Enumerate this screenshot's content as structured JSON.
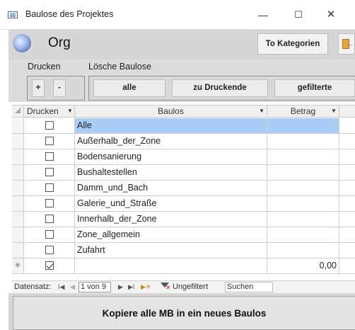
{
  "window": {
    "title": "Baulose des Projektes",
    "minimize_glyph": "—",
    "maximize_glyph": "☐",
    "close_glyph": "✕"
  },
  "header": {
    "title": "Org",
    "to_categories_label": "To Kategorien"
  },
  "controls": {
    "drucken_label": "Drucken",
    "loesche_label": "Lösche Baulose",
    "plus_label": "+",
    "minus_label": "-",
    "alle_label": "alle",
    "zu_druckende_label": "zu Druckende",
    "gefilterte_label": "gefilterte"
  },
  "table": {
    "columns": [
      "Drucken",
      "Baulos",
      "Betrag"
    ],
    "rows": [
      {
        "drucken": false,
        "baulos": "Alle",
        "betrag": "",
        "selected": true
      },
      {
        "drucken": false,
        "baulos": "Außerhalb_der_Zone",
        "betrag": ""
      },
      {
        "drucken": false,
        "baulos": "Bodensanierung",
        "betrag": ""
      },
      {
        "drucken": false,
        "baulos": "Bushaltestellen",
        "betrag": ""
      },
      {
        "drucken": false,
        "baulos": "Damm_und_Bach",
        "betrag": ""
      },
      {
        "drucken": false,
        "baulos": "Galerie_und_Straße",
        "betrag": ""
      },
      {
        "drucken": false,
        "baulos": "Innerhalb_der_Zone",
        "betrag": ""
      },
      {
        "drucken": false,
        "baulos": "Zone_allgemein",
        "betrag": ""
      },
      {
        "drucken": false,
        "baulos": "Zufahrt",
        "betrag": ""
      }
    ],
    "new_row": {
      "marker": "✳",
      "drucken": true,
      "baulos": "",
      "betrag": "0,00"
    }
  },
  "navigation": {
    "label": "Datensatz:",
    "position": "1 von 9",
    "filter_label": "Ungefiltert",
    "search_label": "Suchen"
  },
  "bottom": {
    "copy_button_label": "Kopiere alle MB in ein neues Baulos"
  }
}
